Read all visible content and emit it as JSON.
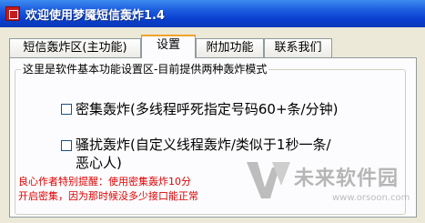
{
  "window": {
    "title": "欢迎使用梦魇短信轰炸1.4"
  },
  "tabs": [
    {
      "label": "短信轰炸区(主功能)"
    },
    {
      "label": "设置"
    },
    {
      "label": "附加功能"
    },
    {
      "label": "联系我们"
    }
  ],
  "settings": {
    "group_title": "这里是软件基本功能设置区-目前提供两种轰炸模式",
    "options": [
      {
        "label": "密集轰炸(多线程呼死指定号码60+条/分钟)",
        "checked": false
      },
      {
        "label_line1": "骚扰轰炸(自定义线程轰炸/类似于1秒一条/",
        "label_line2": "恶心人)",
        "checked": false
      }
    ],
    "warning_line1": "良心作者特别提醒：使用密集轰炸10分",
    "warning_line2": "开启密集，因为那时候没多少接口能正常"
  },
  "watermark": {
    "text": "未来软件园",
    "url": "www.orsoon.com"
  }
}
